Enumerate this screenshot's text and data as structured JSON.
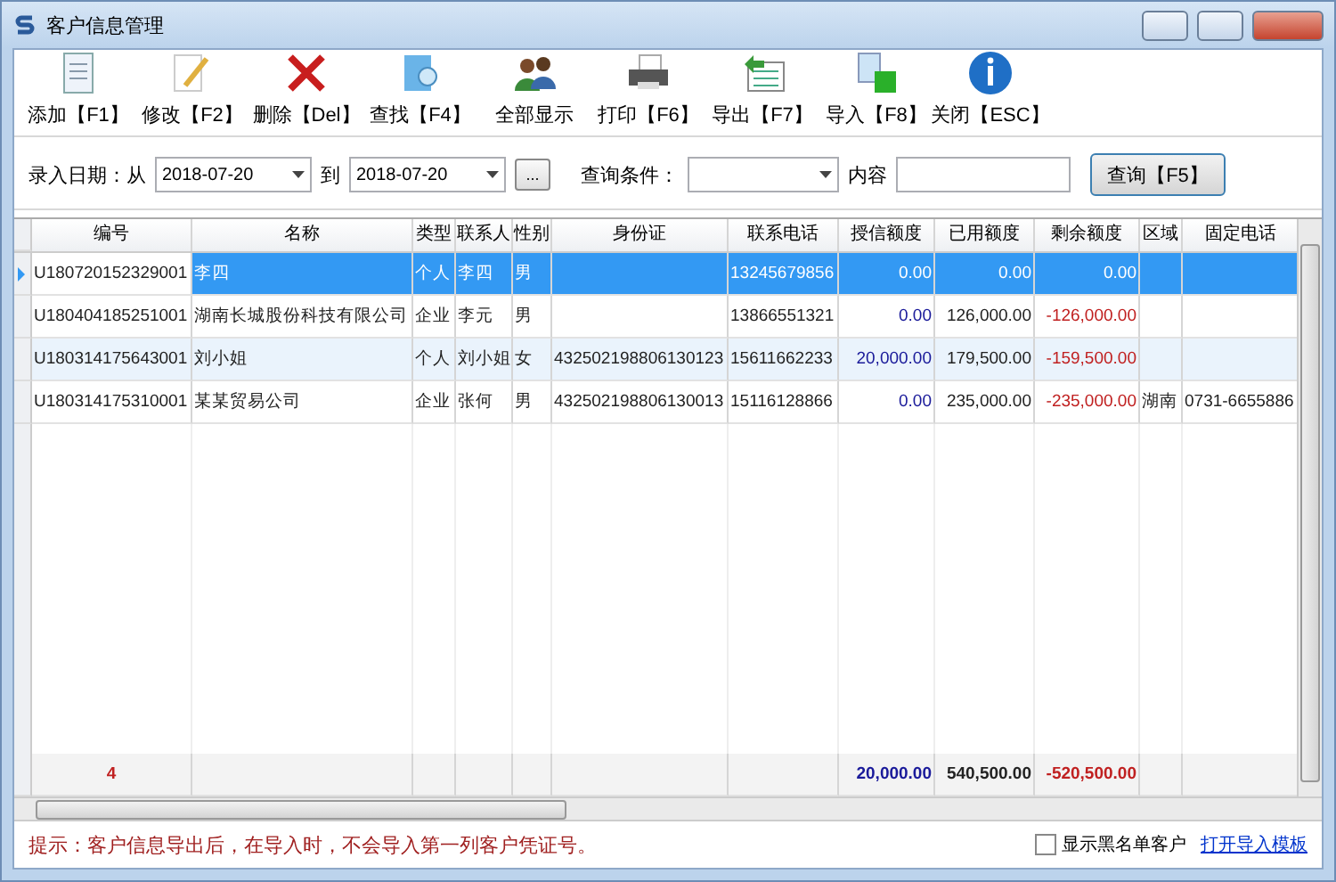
{
  "window": {
    "title": "客户信息管理"
  },
  "toolbar": [
    {
      "label": "添加【F1】",
      "kind": "add"
    },
    {
      "label": "修改【F2】",
      "kind": "edit"
    },
    {
      "label": "删除【Del】",
      "kind": "delete"
    },
    {
      "label": "查找【F4】",
      "kind": "find"
    },
    {
      "label": "全部显示",
      "kind": "all"
    },
    {
      "label": "打印【F6】",
      "kind": "print"
    },
    {
      "label": "导出【F7】",
      "kind": "export"
    },
    {
      "label": "导入【F8】",
      "kind": "import"
    },
    {
      "label": "关闭【ESC】",
      "kind": "close"
    }
  ],
  "filter": {
    "date_label": "录入日期：从",
    "date_from": "2018-07-20",
    "to_label": "到",
    "date_to": "2018-07-20",
    "more_button": "...",
    "condition_label": "查询条件：",
    "content_label": "内容",
    "query_button": "查询【F5】"
  },
  "table": {
    "columns": [
      "编号",
      "名称",
      "类型",
      "联系人",
      "性别",
      "身份证",
      "联系电话",
      "授信额度",
      "已用额度",
      "剩余额度",
      "区域",
      "固定电话"
    ],
    "rows": [
      {
        "selected": true,
        "cells": [
          "U180720152329001",
          "李四",
          "个人",
          "李四",
          "男",
          null,
          "13245679856",
          "0.00",
          "0.00",
          "0.00",
          null,
          null
        ]
      },
      {
        "selected": false,
        "cells": [
          "U180404185251001",
          "湖南长城股份科技有限公司",
          "企业",
          "李元",
          "男",
          null,
          "13866551321",
          "0.00",
          "126,000.00",
          "-126,000.00",
          null,
          null
        ]
      },
      {
        "selected": false,
        "cells": [
          "U180314175643001",
          "刘小姐",
          "个人",
          "刘小姐",
          "女",
          "432502198806130123",
          "15611662233",
          "20,000.00",
          "179,500.00",
          "-159,500.00",
          null,
          null
        ]
      },
      {
        "selected": false,
        "cells": [
          "U180314175310001",
          "某某贸易公司",
          "企业",
          "张何",
          "男",
          "432502198806130013",
          "15116128866",
          "0.00",
          "235,000.00",
          "-235,000.00",
          "湖南",
          "0731-6655886"
        ]
      }
    ],
    "totals": {
      "count": "4",
      "credit": "20,000.00",
      "used": "540,500.00",
      "remaining": "-520,500.00"
    }
  },
  "footer": {
    "hint": "提示：客户信息导出后，在导入时，不会导入第一列客户凭证号。",
    "blacklist_checkbox": {
      "label": "显示黑名单客户",
      "checked": false
    },
    "template_link": "打开导入模板"
  }
}
